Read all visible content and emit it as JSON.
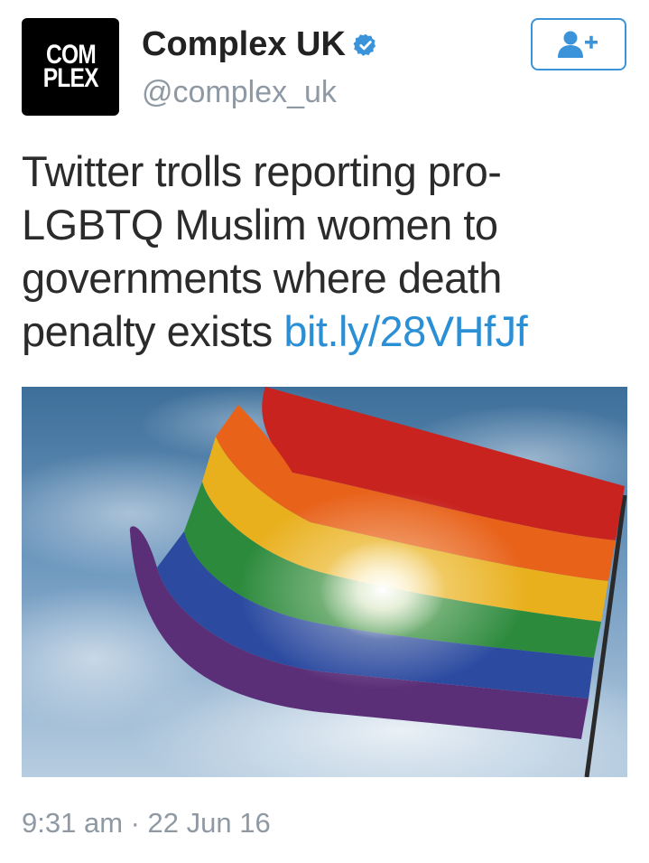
{
  "account": {
    "avatar_line1": "COM",
    "avatar_line2": "PLEX",
    "display_name": "Complex UK",
    "handle": "@complex_uk",
    "verified_icon": "verified-badge-icon"
  },
  "follow_button": {
    "icon": "follow-user-plus-icon",
    "color": "#3b94d9"
  },
  "tweet": {
    "line1": "Twitter trolls reporting pro-",
    "line2": "LGBTQ Muslim women to",
    "line3": "governments where death",
    "line4_text": "penalty exists ",
    "link": "bit.ly/28VHfJf",
    "link_color": "#2b8fd6"
  },
  "media": {
    "description_icon": "rainbow-flag-photo"
  },
  "meta": {
    "timestamp": "9:31 am · 22 Jun 16"
  }
}
